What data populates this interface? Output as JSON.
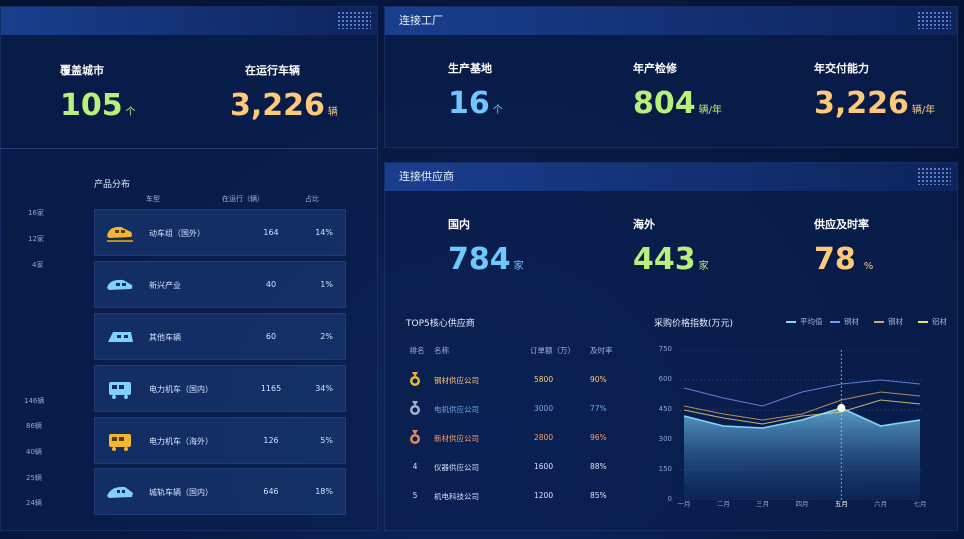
{
  "left_top": {
    "kpis": [
      {
        "label": "覆盖城市",
        "value": "105",
        "unit": "个"
      },
      {
        "label": "在运行车辆",
        "value": "3,226",
        "unit": "辆"
      }
    ]
  },
  "products": {
    "title": "产品分布",
    "headers": {
      "type": "车型",
      "running": "在运行（辆）",
      "ratio": "占比"
    },
    "rows": [
      {
        "name": "动车组（国外）",
        "count": "164",
        "pct": "14%",
        "icon": "train-icon-gold"
      },
      {
        "name": "新兴产业",
        "count": "40",
        "pct": "1%",
        "icon": "train-icon-blue"
      },
      {
        "name": "其他车辆",
        "count": "60",
        "pct": "2%",
        "icon": "train-icon-blue"
      },
      {
        "name": "电力机车（国内）",
        "count": "1165",
        "pct": "34%",
        "icon": "locomotive-icon-blue"
      },
      {
        "name": "电力机车（海外）",
        "count": "126",
        "pct": "5%",
        "icon": "locomotive-icon-gold"
      },
      {
        "name": "城轨车辆（国内）",
        "count": "646",
        "pct": "18%",
        "icon": "metro-icon-blue"
      }
    ],
    "side_labels_top": [
      "16家",
      "12家",
      "4家"
    ],
    "side_labels_bottom": [
      "146辆",
      "86辆",
      "40辆",
      "25辆",
      "24辆"
    ]
  },
  "factory": {
    "title": "连接工厂",
    "kpis": [
      {
        "label": "生产基地",
        "value": "16",
        "unit": "个"
      },
      {
        "label": "年产检修",
        "value": "804",
        "unit": "辆/年"
      },
      {
        "label": "年交付能力",
        "value": "3,226",
        "unit": "辆/年"
      }
    ]
  },
  "supplier": {
    "title": "连接供应商",
    "kpis": [
      {
        "label": "国内",
        "value": "784",
        "unit": "家"
      },
      {
        "label": "海外",
        "value": "443",
        "unit": "家"
      },
      {
        "label": "供应及时率",
        "value": "78",
        "unit": "%"
      }
    ],
    "top5": {
      "title": "TOP5核心供应商",
      "headers": {
        "rank": "排名",
        "name": "名称",
        "orders": "订单额（万）",
        "ontime": "及时率"
      },
      "rows": [
        {
          "rank": "1",
          "name": "钢材供应公司",
          "orders": "5800",
          "ontime": "90%",
          "color": "#ffc97a"
        },
        {
          "rank": "2",
          "name": "电机供应公司",
          "orders": "3000",
          "ontime": "77%",
          "color": "#6fa8e8"
        },
        {
          "rank": "3",
          "name": "新材供应公司",
          "orders": "2800",
          "ontime": "96%",
          "color": "#ff9d6a"
        },
        {
          "rank": "4",
          "name": "仪器供应公司",
          "orders": "1600",
          "ontime": "88%",
          "color": "#d4e2ff"
        },
        {
          "rank": "5",
          "name": "机电科技公司",
          "orders": "1200",
          "ontime": "85%",
          "color": "#d4e2ff"
        }
      ]
    }
  },
  "chart_data": {
    "type": "line",
    "title": "采购价格指数(万元)",
    "categories": [
      "一月",
      "二月",
      "三月",
      "四月",
      "五月",
      "六月",
      "七月"
    ],
    "ylim": [
      0,
      750
    ],
    "yticks": [
      "750",
      "600",
      "450",
      "300",
      "150",
      "0"
    ],
    "series": [
      {
        "name": "平均值",
        "color": "#7fd6ff",
        "values": [
          420,
          370,
          360,
          400,
          460,
          370,
          400
        ]
      },
      {
        "name": "铜材",
        "color": "#6f9cf0",
        "values": [
          560,
          510,
          470,
          540,
          580,
          600,
          580
        ]
      },
      {
        "name": "钢材",
        "color": "#e0a070",
        "values": [
          470,
          430,
          400,
          430,
          500,
          540,
          520
        ]
      },
      {
        "name": "铝材",
        "color": "#e8e070",
        "values": [
          450,
          410,
          380,
          420,
          440,
          500,
          480
        ]
      }
    ],
    "highlight_index": 4
  }
}
